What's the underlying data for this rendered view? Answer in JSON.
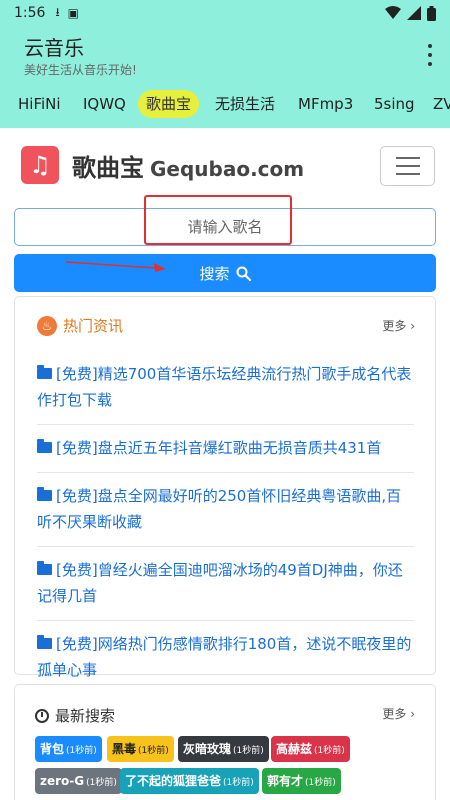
{
  "status_bar": {
    "time": "1:56"
  },
  "app": {
    "title": "云音乐",
    "subtitle": "美好生活从音乐开始!"
  },
  "tabs": [
    {
      "label": "HiFiNi"
    },
    {
      "label": "IQWQ"
    },
    {
      "label": "歌曲宝"
    },
    {
      "label": "无损生活"
    },
    {
      "label": "MFmp3"
    },
    {
      "label": "5sing"
    },
    {
      "label": "ZV"
    }
  ],
  "site": {
    "name": "歌曲宝",
    "domain": "Gequbao.com"
  },
  "search": {
    "placeholder": "请输入歌名",
    "button_label": "搜索"
  },
  "news": {
    "title": "热门资讯",
    "more": "更多",
    "items": [
      {
        "text": "[免费]精选700首华语乐坛经典流行热门歌手成名代表作打包下载"
      },
      {
        "text": "[免费]盘点近五年抖音爆红歌曲无损音质共431首"
      },
      {
        "text": "[免费]盘点全网最好听的250首怀旧经典粤语歌曲,百听不厌果断收藏"
      },
      {
        "text": "[免费]曾经火遍全国迪吧溜冰场的49首DJ神曲，你还记得几首"
      },
      {
        "text": "[免费]网络热门伤感情歌排行180首，述说不眠夜里的孤单心事"
      }
    ]
  },
  "recent": {
    "title": "最新搜索",
    "more": "更多",
    "tags": [
      {
        "text": "背包",
        "time": "(1秒前)",
        "color": "#1a8cff"
      },
      {
        "text": "黑毒",
        "time": "(1秒前)",
        "color": "#f7c21a"
      },
      {
        "text": "灰暗玫瑰",
        "time": "(1秒前)",
        "color": "#343a40"
      },
      {
        "text": "高赫兹",
        "time": "(1秒前)",
        "color": "#d9344a"
      },
      {
        "text": "zero-G",
        "time": "(1秒前)",
        "color": "#6c757d"
      },
      {
        "text": "了不起的狐狸爸爸",
        "time": "(1秒前)",
        "color": "#17a2b8"
      },
      {
        "text": "郭有才",
        "time": "(1秒前)",
        "color": "#28a745"
      }
    ]
  }
}
